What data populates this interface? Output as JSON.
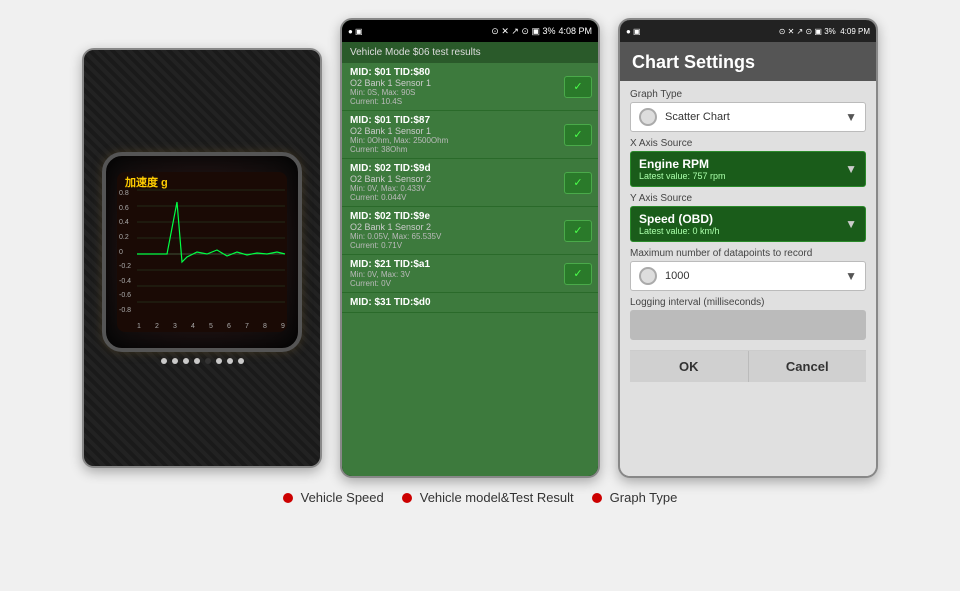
{
  "screen1": {
    "title": "加速度 g",
    "y_labels": [
      "0.8",
      "0.6",
      "0.4",
      "0.2",
      "0",
      "-0.2",
      "-0.4",
      "-0.6",
      "-0.8"
    ],
    "x_labels": [
      "9",
      "8",
      "7",
      "6",
      "5",
      "4",
      "3",
      "2",
      "1"
    ],
    "dots_count": 8,
    "active_dot": 5
  },
  "screen2": {
    "status_bar": {
      "left": "● ▣",
      "right": "⊙ ✕ ↗ ⊙ ▣ 3% 4:08 PM"
    },
    "header": "Vehicle Mode $06 test results",
    "items": [
      {
        "title": "MID: $01 TID:$80",
        "sub": "O2 Bank 1 Sensor 1",
        "detail": "Min: 0S, Max: 90S\nCurrent: 10.4S",
        "ok": true
      },
      {
        "title": "MID: $01 TID:$87",
        "sub": "O2 Bank 1 Sensor 1",
        "detail": "Min: 0Ohm, Max: 2500Ohm\nCurrent: 380hm",
        "ok": true
      },
      {
        "title": "MID: $02 TID:$9d",
        "sub": "O2 Bank 1 Sensor 2",
        "detail": "Min: 0V, Max: 0.433V\nCurrent: 0.044V",
        "ok": true
      },
      {
        "title": "MID: $02 TID:$9e",
        "sub": "O2 Bank 1 Sensor 2",
        "detail": "Min: 0.05V, Max: 65.535V\nCurrent: 0.71V",
        "ok": true
      },
      {
        "title": "MID: $21 TID:$a1",
        "sub": "",
        "detail": "Min: 0V, Max: 3V\nCurrent: 0V",
        "ok": true
      },
      {
        "title": "MID: $31 TID:$d0",
        "sub": "",
        "detail": "",
        "ok": false
      }
    ]
  },
  "screen3": {
    "status_bar": {
      "left": "● ▣",
      "right": "⊙ ✕ ↗ ⊙ ▣ 3% 4:09 PM"
    },
    "title": "Chart Settings",
    "graph_type_label": "Graph Type",
    "graph_type_value": "Scatter Chart",
    "x_axis_label": "X Axis Source",
    "x_axis_value": "Engine RPM",
    "x_axis_sub": "Latest value: 757 rpm",
    "y_axis_label": "Y Axis Source",
    "y_axis_value": "Speed (OBD)",
    "y_axis_sub": "Latest value: 0 km/h",
    "max_datapoints_label": "Maximum number of datapoints to record",
    "max_datapoints_value": "1000",
    "logging_label": "Logging interval (milliseconds)",
    "ok_button": "OK",
    "cancel_button": "Cancel"
  },
  "labels": [
    {
      "text": "Vehicle Speed",
      "dot_color": "#cc0000"
    },
    {
      "text": "Vehicle model&Test Result",
      "dot_color": "#cc0000"
    },
    {
      "text": "Graph Type",
      "dot_color": "#cc0000"
    }
  ]
}
